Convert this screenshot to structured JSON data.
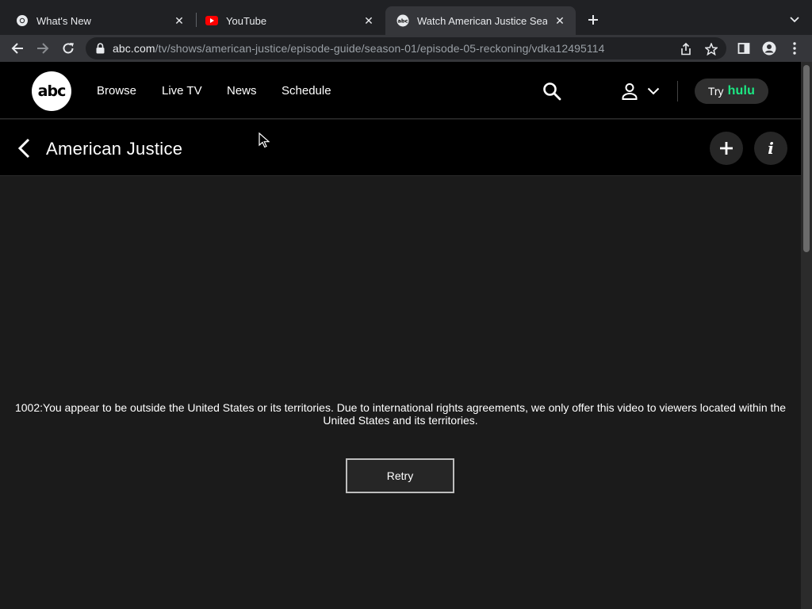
{
  "browser": {
    "tabs": [
      {
        "title": "What's New",
        "icon": "chrome-icon",
        "active": false
      },
      {
        "title": "YouTube",
        "icon": "youtube-icon",
        "active": false
      },
      {
        "title": "Watch American Justice Season",
        "icon": "abc-favicon-icon",
        "active": true
      }
    ],
    "url_host": "abc.com",
    "url_path": "/tv/shows/american-justice/episode-guide/season-01/episode-05-reckoning/vdka12495114",
    "colors": {
      "tabbar": "#202124",
      "toolbar": "#35363a",
      "omnibox": "#202124"
    }
  },
  "site": {
    "logo_text": "abc",
    "nav": [
      "Browse",
      "Live TV",
      "News",
      "Schedule"
    ],
    "try_label": "Try",
    "hulu_label": "hulu",
    "colors": {
      "header": "#000000",
      "hulu_green": "#1ce783",
      "player_bg": "#1b1b1b"
    }
  },
  "show": {
    "title": "American Justice"
  },
  "player": {
    "error_message": "1002:You appear to be outside the United States or its territories. Due to international rights agreements, we only offer this video to viewers located within the United States and its territories.",
    "retry_label": "Retry"
  }
}
